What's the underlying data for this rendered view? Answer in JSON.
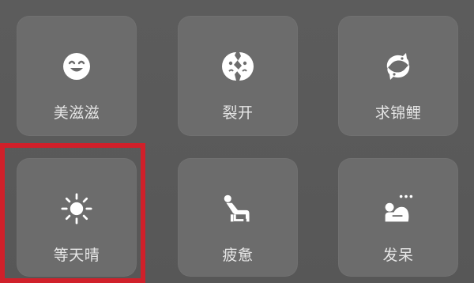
{
  "moods": [
    {
      "label": "美滋滋",
      "icon": "smile-icon"
    },
    {
      "label": "裂开",
      "icon": "cracked-face-icon"
    },
    {
      "label": "求锦鲤",
      "icon": "koi-fish-icon"
    },
    {
      "label": "等天晴",
      "icon": "sun-icon"
    },
    {
      "label": "疲惫",
      "icon": "tired-person-icon"
    },
    {
      "label": "发呆",
      "icon": "daydream-person-icon"
    }
  ],
  "highlight": {
    "color": "#d0202a",
    "target": "等天晴"
  },
  "colors": {
    "background": "#5a5a5a",
    "tile": "#6c6c6c",
    "icon": "#ffffff",
    "label": "#e6e6e6"
  }
}
